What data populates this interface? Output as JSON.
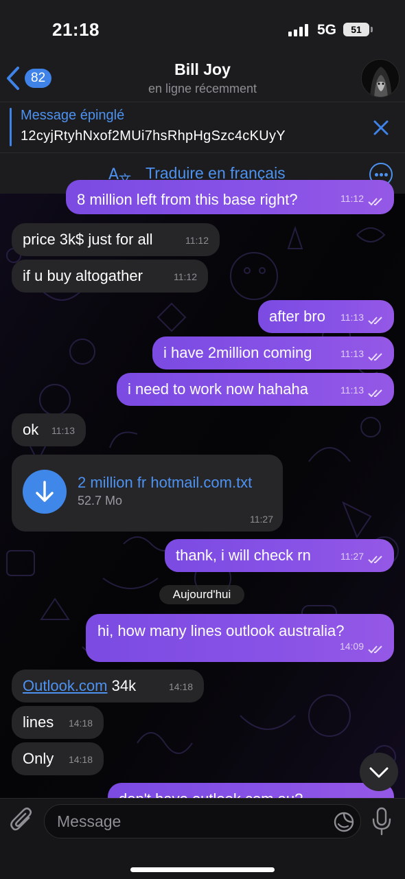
{
  "status_bar": {
    "time": "21:18",
    "network": "5G",
    "battery": "51"
  },
  "header": {
    "back_count": "82",
    "contact_name": "Bill Joy",
    "contact_status": "en ligne récemment"
  },
  "pinned": {
    "title": "Message épinglé",
    "text": "12cyjRtyhNxof2MUi7hsRhpHgSzc4cKUyY"
  },
  "translate": {
    "label": "Traduire en français"
  },
  "messages": [
    {
      "dir": "out",
      "text": "8 million left from this base right?",
      "time": "11:12"
    },
    {
      "dir": "in",
      "text": "price 3k$ just for all",
      "time": "11:12"
    },
    {
      "dir": "in",
      "text": "if u buy altogather",
      "time": "11:12"
    },
    {
      "dir": "out",
      "text": "after bro",
      "time": "11:13"
    },
    {
      "dir": "out",
      "text": "i have 2million coming",
      "time": "11:13"
    },
    {
      "dir": "out",
      "text": "i need to work now hahaha",
      "time": "11:13"
    },
    {
      "dir": "in",
      "text": "ok",
      "time": "11:13"
    },
    {
      "dir": "out",
      "text": "thank, i will check rn",
      "time": "11:27"
    },
    {
      "dir": "out",
      "text": "hi, how many lines outlook australia?",
      "time": "14:09"
    },
    {
      "dir": "in",
      "link": "Outlook.com",
      "text": " 34k",
      "time": "14:18"
    },
    {
      "dir": "in",
      "text": "lines",
      "time": "14:18"
    },
    {
      "dir": "in",
      "text": "Only",
      "time": "14:18"
    },
    {
      "dir": "out",
      "text": "don't have outlook.com.au?",
      "time": ""
    }
  ],
  "file": {
    "name": "2 million fr hotmail.com.txt",
    "size": "52.7 Mo",
    "time": "11:27"
  },
  "date_separator": "Aujourd'hui",
  "input": {
    "placeholder": "Message"
  },
  "colors": {
    "accent": "#3f83e8",
    "outgoing": "#8852e6",
    "incoming": "#262628"
  }
}
